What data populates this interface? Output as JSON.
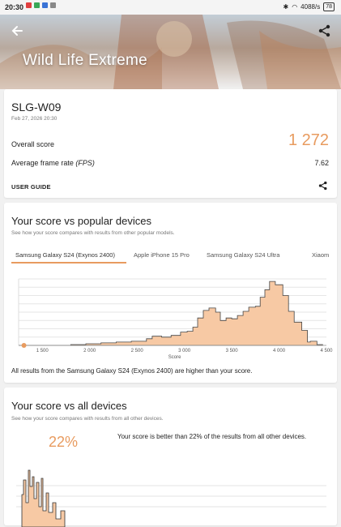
{
  "status": {
    "time": "20:30",
    "speed": "4088/s",
    "battery": "78"
  },
  "header": {
    "title": "Wild Life Extreme"
  },
  "result": {
    "device": "SLG-W09",
    "date": "Feb 27, 2026 20:30",
    "overall_label": "Overall score",
    "overall_value": "1 272",
    "fps_label_main": "Average frame rate ",
    "fps_label_unit": "(FPS)",
    "fps_value": "7.62",
    "guide_label": "USER GUIDE"
  },
  "popular": {
    "title": "Your score vs popular devices",
    "subtitle": "See how your score compares with results from other popular models.",
    "tabs": [
      "Samsung Galaxy S24 (Exynos 2400)",
      "Apple iPhone 15 Pro",
      "Samsung Galaxy S24 Ultra",
      "Xiaom"
    ],
    "note": "All results from the Samsung Galaxy S24 (Exynos 2400) are higher than your score."
  },
  "all": {
    "title": "Your score vs all devices",
    "subtitle": "See how your score compares with results from all other devices.",
    "percent": "22%",
    "text": "Your score is better than 22% of the results from all other devices."
  },
  "colors": {
    "accent": "#e89b5f",
    "fill": "#f7c9a4"
  },
  "chart_data": {
    "type": "area",
    "xlabel": "Score",
    "x_ticks": [
      1500,
      2000,
      2500,
      3000,
      3500,
      4000,
      4500
    ],
    "x_tick_labels": [
      "1 500",
      "2 000",
      "2 500",
      "3 000",
      "3 500",
      "4 000",
      "4 500"
    ],
    "xlim": [
      1250,
      4500
    ],
    "your_score": 1272,
    "series": [
      {
        "values": [
          [
            1250,
            0
          ],
          [
            1800,
            0
          ],
          [
            1800,
            1
          ],
          [
            1960,
            1
          ],
          [
            1960,
            2
          ],
          [
            2120,
            2
          ],
          [
            2120,
            3
          ],
          [
            2280,
            3
          ],
          [
            2280,
            4
          ],
          [
            2440,
            4
          ],
          [
            2440,
            5
          ],
          [
            2600,
            5
          ],
          [
            2600,
            8
          ],
          [
            2660,
            8
          ],
          [
            2660,
            11
          ],
          [
            2760,
            11
          ],
          [
            2760,
            10
          ],
          [
            2860,
            10
          ],
          [
            2860,
            12
          ],
          [
            2960,
            12
          ],
          [
            2960,
            16
          ],
          [
            3030,
            16
          ],
          [
            3030,
            17
          ],
          [
            3090,
            17
          ],
          [
            3090,
            22
          ],
          [
            3140,
            22
          ],
          [
            3140,
            33
          ],
          [
            3200,
            33
          ],
          [
            3200,
            42
          ],
          [
            3260,
            42
          ],
          [
            3260,
            45
          ],
          [
            3330,
            45
          ],
          [
            3330,
            40
          ],
          [
            3380,
            40
          ],
          [
            3380,
            30
          ],
          [
            3440,
            30
          ],
          [
            3440,
            33
          ],
          [
            3500,
            33
          ],
          [
            3500,
            32
          ],
          [
            3560,
            32
          ],
          [
            3560,
            36
          ],
          [
            3620,
            36
          ],
          [
            3620,
            41
          ],
          [
            3680,
            41
          ],
          [
            3680,
            46
          ],
          [
            3750,
            46
          ],
          [
            3750,
            47
          ],
          [
            3800,
            47
          ],
          [
            3800,
            58
          ],
          [
            3850,
            58
          ],
          [
            3850,
            67
          ],
          [
            3900,
            67
          ],
          [
            3900,
            77
          ],
          [
            3960,
            77
          ],
          [
            3960,
            73
          ],
          [
            4040,
            73
          ],
          [
            4040,
            60
          ],
          [
            4100,
            60
          ],
          [
            4100,
            41
          ],
          [
            4160,
            41
          ],
          [
            4160,
            28
          ],
          [
            4240,
            28
          ],
          [
            4240,
            18
          ],
          [
            4300,
            18
          ],
          [
            4300,
            4
          ],
          [
            4330,
            4
          ],
          [
            4330,
            5
          ],
          [
            4400,
            5
          ],
          [
            4400,
            1
          ],
          [
            4460,
            1
          ],
          [
            4460,
            0
          ]
        ]
      }
    ]
  }
}
